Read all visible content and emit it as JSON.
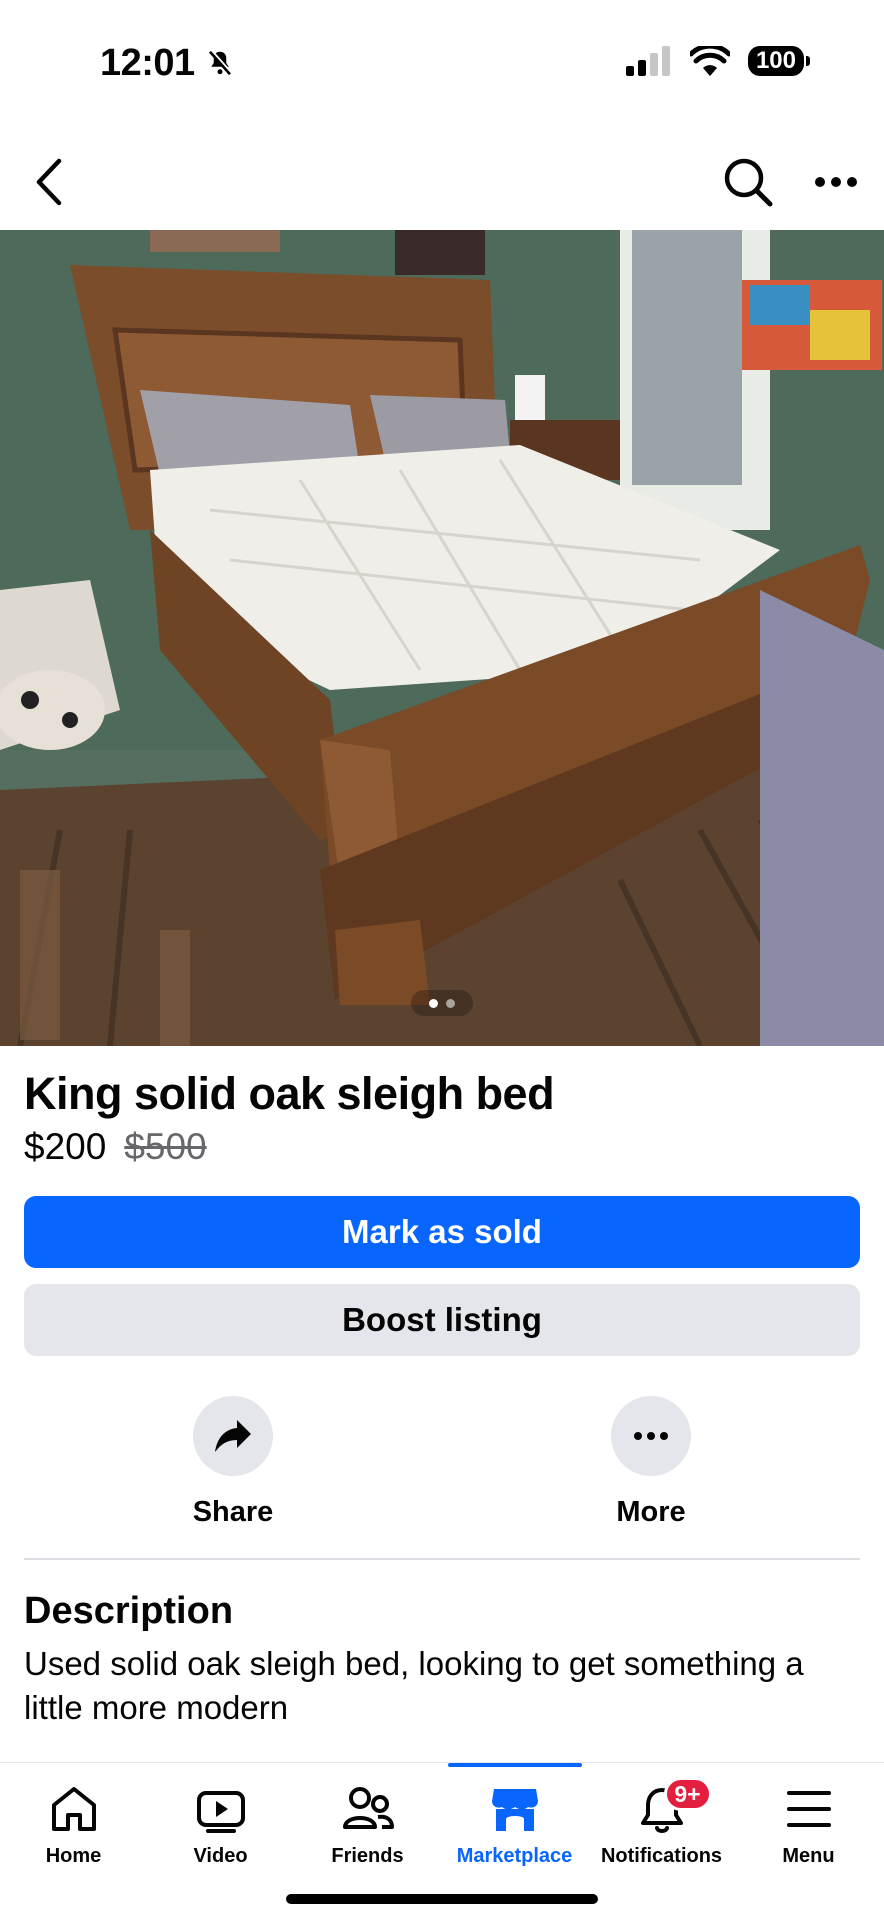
{
  "status_bar": {
    "time": "12:01",
    "battery": "100"
  },
  "listing": {
    "title": "King solid oak sleigh bed",
    "price": "$200",
    "original_price": "$500",
    "photo_index": 1,
    "photo_count": 2
  },
  "buttons": {
    "primary": "Mark as sold",
    "secondary": "Boost listing"
  },
  "actions": [
    {
      "label": "Share",
      "icon": "share-icon"
    },
    {
      "label": "More",
      "icon": "more-icon"
    }
  ],
  "description": {
    "heading": "Description",
    "text": "Used solid oak sleigh bed, looking to get something a little more modern"
  },
  "tabs": [
    {
      "label": "Home",
      "icon": "home-icon"
    },
    {
      "label": "Video",
      "icon": "video-icon"
    },
    {
      "label": "Friends",
      "icon": "friends-icon"
    },
    {
      "label": "Marketplace",
      "icon": "marketplace-icon",
      "active": true
    },
    {
      "label": "Notifications",
      "icon": "bell-icon",
      "badge": "9+"
    },
    {
      "label": "Menu",
      "icon": "menu-icon"
    }
  ],
  "colors": {
    "accent": "#0866ff",
    "badge": "#e41e3f",
    "secondary_bg": "#e4e6eb"
  }
}
